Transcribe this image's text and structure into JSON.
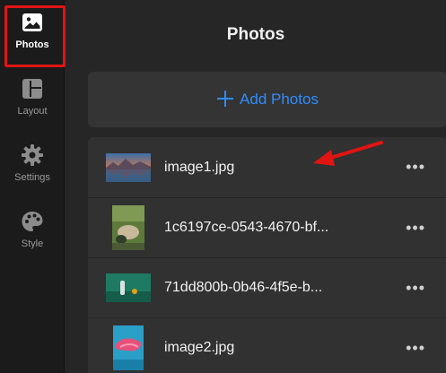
{
  "sidebar": {
    "items": [
      {
        "label": "Photos",
        "icon": "image-icon",
        "active": true
      },
      {
        "label": "Layout",
        "icon": "layout-icon",
        "active": false
      },
      {
        "label": "Settings",
        "icon": "gear-icon",
        "active": false
      },
      {
        "label": "Style",
        "icon": "palette-icon",
        "active": false
      }
    ]
  },
  "main": {
    "title": "Photos",
    "add_button": {
      "label": "Add Photos",
      "icon": "plus-icon"
    },
    "photos": [
      {
        "name": "image1.jpg",
        "more": "•••"
      },
      {
        "name": "1c6197ce-0543-4670-bf...",
        "more": "•••"
      },
      {
        "name": "71dd800b-0b46-4f5e-b...",
        "more": "•••"
      },
      {
        "name": "image2.jpg",
        "more": "•••"
      }
    ]
  },
  "colors": {
    "accent": "#2f8cff",
    "highlight": "#e11414",
    "sidebar_bg": "#1b1b1b",
    "panel_bg": "#262626"
  }
}
